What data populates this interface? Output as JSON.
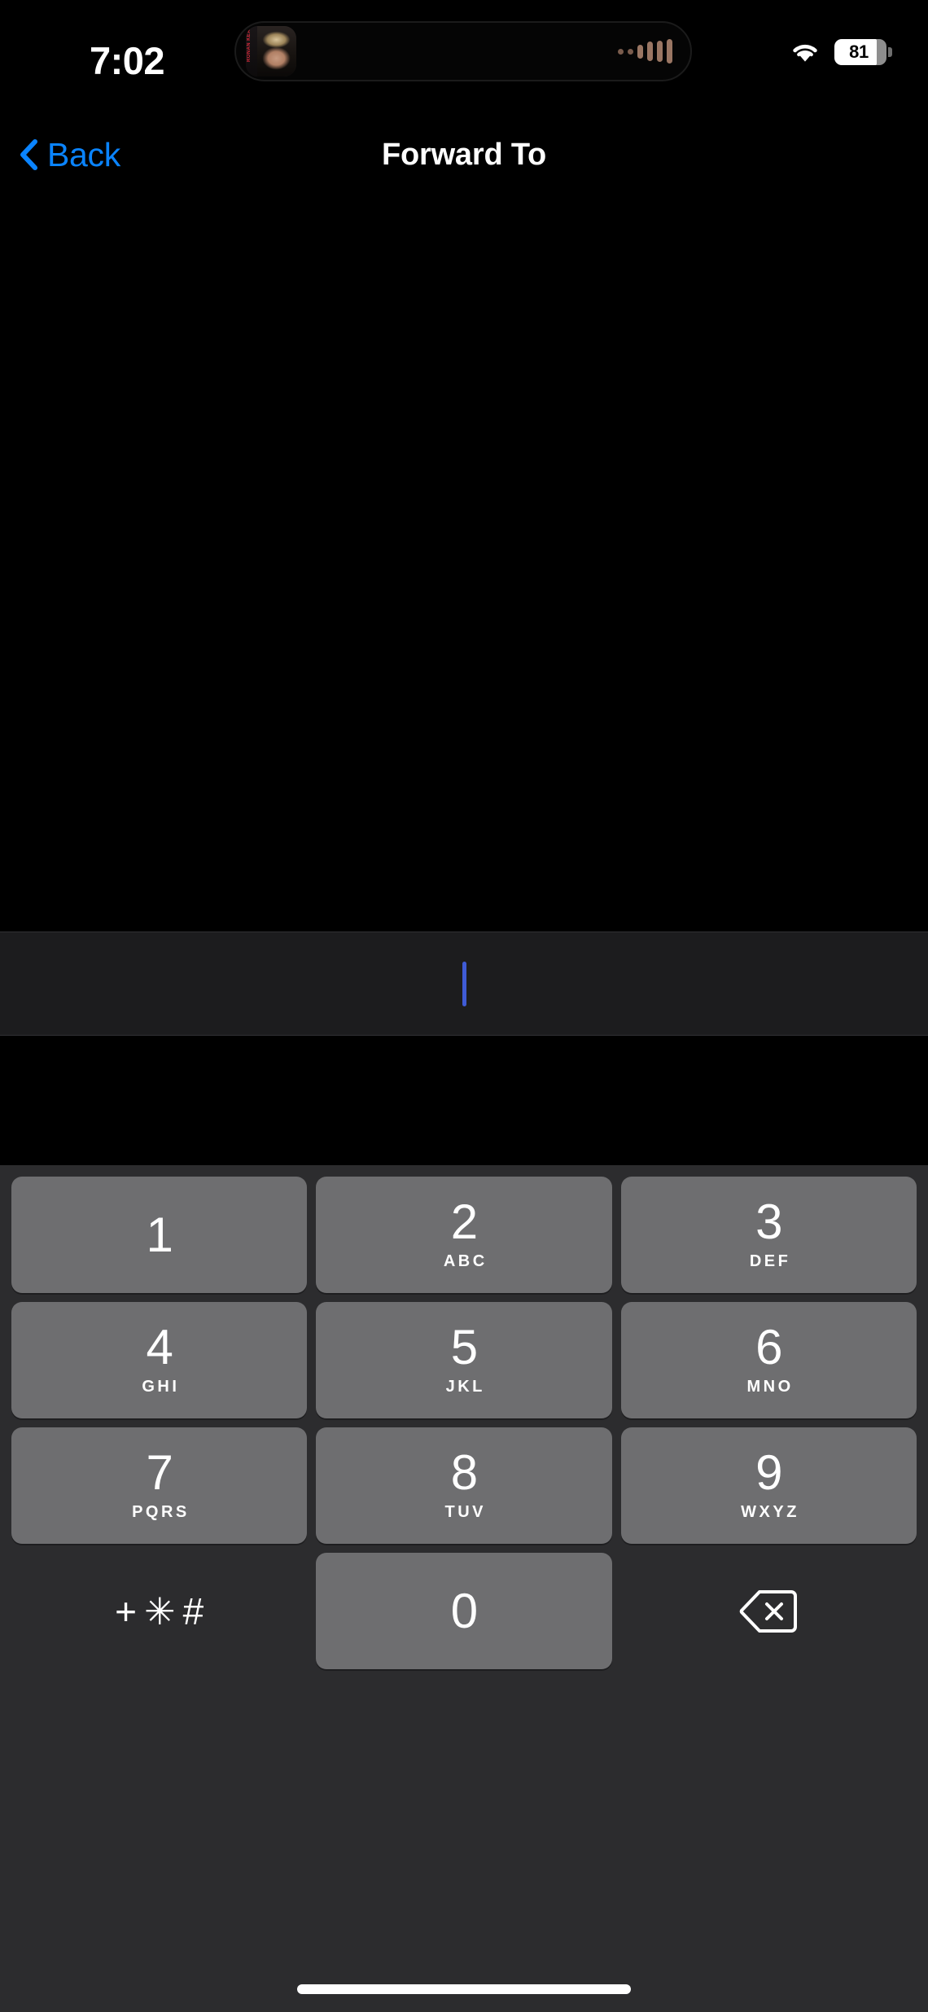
{
  "status_bar": {
    "time": "7:02",
    "dynamic_island": {
      "album_art_text": "RONAN KEATING",
      "waveform_icon": "audio-waveform-icon"
    },
    "wifi_icon": "wifi-icon",
    "battery": {
      "level": "81",
      "percent": 81
    }
  },
  "nav_bar": {
    "back_icon": "chevron-left-icon",
    "back_label": "Back",
    "title": "Forward To"
  },
  "recipient_field": {
    "value": "",
    "placeholder": "",
    "caret_color": "#3f5bd6"
  },
  "keypad": {
    "rows": [
      [
        {
          "digit": "1",
          "letters": ""
        },
        {
          "digit": "2",
          "letters": "ABC"
        },
        {
          "digit": "3",
          "letters": "DEF"
        }
      ],
      [
        {
          "digit": "4",
          "letters": "GHI"
        },
        {
          "digit": "5",
          "letters": "JKL"
        },
        {
          "digit": "6",
          "letters": "MNO"
        }
      ],
      [
        {
          "digit": "7",
          "letters": "PQRS"
        },
        {
          "digit": "8",
          "letters": "TUV"
        },
        {
          "digit": "9",
          "letters": "WXYZ"
        }
      ]
    ],
    "bottom_row": {
      "symbols_label": "+✳#",
      "symbols_name": "plus-asterisk-hash-key",
      "zero_digit": "0",
      "delete_icon": "backspace-delete-icon"
    },
    "key_color": "#6e6e70",
    "background_color": "#2c2c2e"
  },
  "home_indicator": {
    "name": "home-indicator"
  },
  "theme": {
    "accent": "#0a84ff",
    "background": "#000000",
    "field_background": "#1c1c1e"
  }
}
